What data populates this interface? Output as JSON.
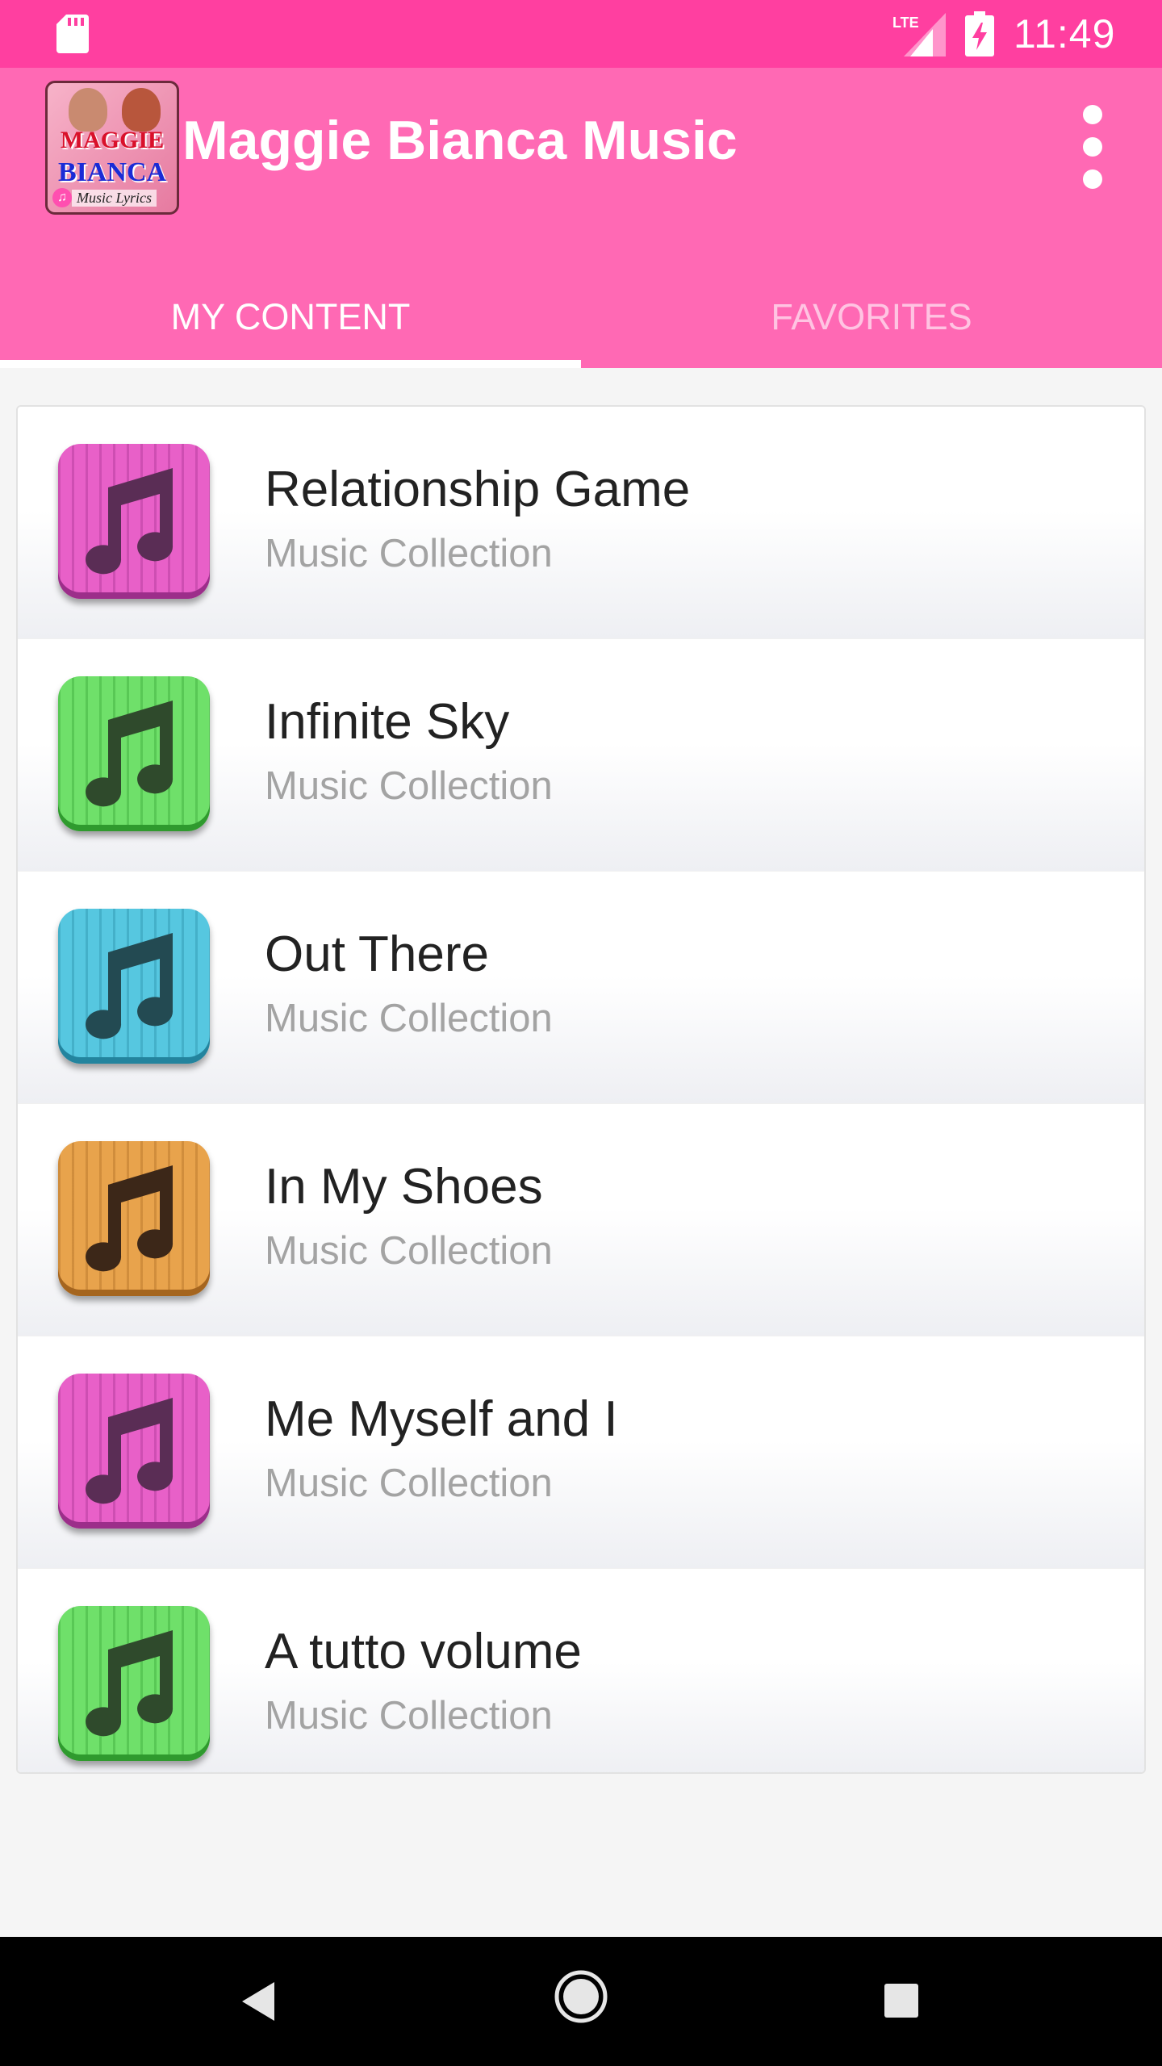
{
  "status_bar": {
    "time": "11:49",
    "icons": [
      "sd-card-icon",
      "lte-signal-icon",
      "battery-charging-icon"
    ]
  },
  "app_bar": {
    "title": "Maggie Bianca Music",
    "logo": {
      "line1": "MAGGIE",
      "line2": "BIANCA",
      "line3": "Music Lyrics"
    },
    "menu_icon": "more-vert-icon",
    "background_color": "#ff69b4",
    "status_color": "#ff3fa0"
  },
  "tabs": [
    {
      "label": "MY CONTENT",
      "selected": true
    },
    {
      "label": "FAVORITES",
      "selected": false
    }
  ],
  "list": {
    "items": [
      {
        "title": "Relationship Game",
        "subtitle": "Music Collection",
        "icon": "music-note-icon",
        "icon_color": "#e860c8",
        "icon_dark": "#9c2e8a",
        "note_color": "#5a2d55"
      },
      {
        "title": "Infinite Sky",
        "subtitle": "Music Collection",
        "icon": "music-note-icon",
        "icon_color": "#6fe06a",
        "icon_dark": "#2f9a2e",
        "note_color": "#2f4a2c"
      },
      {
        "title": "Out There",
        "subtitle": "Music Collection",
        "icon": "music-note-icon",
        "icon_color": "#56c7e0",
        "icon_dark": "#23849e",
        "note_color": "#234a52"
      },
      {
        "title": "In My Shoes",
        "subtitle": "Music Collection",
        "icon": "music-note-icon",
        "icon_color": "#e8a34c",
        "icon_dark": "#a5651f",
        "note_color": "#3c2718"
      },
      {
        "title": "Me Myself and I",
        "subtitle": "Music Collection",
        "icon": "music-note-icon",
        "icon_color": "#e860c8",
        "icon_dark": "#9c2e8a",
        "note_color": "#5a2d55"
      },
      {
        "title": "A tutto volume",
        "subtitle": "Music Collection",
        "icon": "music-note-icon",
        "icon_color": "#6fe06a",
        "icon_dark": "#2f9a2e",
        "note_color": "#2f4a2c"
      }
    ]
  },
  "nav_bar": {
    "icons": [
      "back-icon",
      "home-icon",
      "recents-icon"
    ]
  }
}
